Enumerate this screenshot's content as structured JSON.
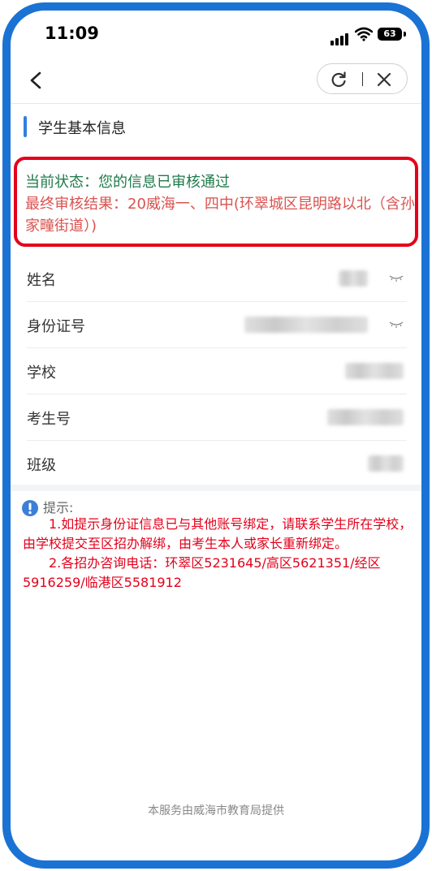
{
  "status_bar": {
    "time": "11:09",
    "battery": "63"
  },
  "section": {
    "title": "学生基本信息"
  },
  "status": {
    "line1": "当前状态：您的信息已审核通过",
    "line2": "最终审核结果：20威海一、四中(环翠城区昆明路以北（含孙家疃街道）)"
  },
  "info_rows": [
    {
      "label": "姓名"
    },
    {
      "label": "身份证号"
    },
    {
      "label": "学校"
    },
    {
      "label": "考生号"
    },
    {
      "label": "班级"
    }
  ],
  "tips": {
    "label": "提示:",
    "item1": "1.如提示身份证信息已与其他账号绑定，请联系学生所在学校，由学校提交至区招办解绑，由考生本人或家长重新绑定。",
    "item2": "2.各招办咨询电话：环翠区5231645/高区5621351/经区5916259/临港区5581912"
  },
  "footer": "本服务由威海市教育局提供",
  "colors": {
    "accent": "#2f7fe0",
    "frame": "#1a73d4",
    "alert_red": "#e4001b",
    "status_green": "#1f7a4a"
  }
}
